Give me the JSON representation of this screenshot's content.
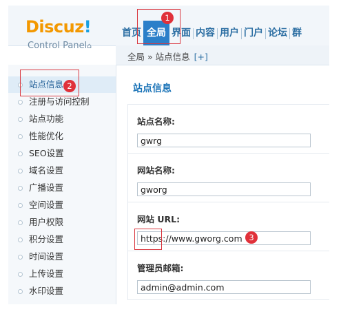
{
  "logo": {
    "brand": "Discuz",
    "bang": "!",
    "subtitle": "Control Panel",
    "subtitle_icon": "home-icon"
  },
  "topnav": {
    "items": [
      "首页",
      "全局",
      "界面",
      "内容",
      "用户",
      "门户",
      "论坛",
      "群"
    ],
    "active_index": 1
  },
  "breadcrumb": {
    "path": "全局 » 站点信息",
    "toggle": "[+]"
  },
  "sidebar": {
    "items": [
      "站点信息",
      "注册与访问控制",
      "站点功能",
      "性能优化",
      "SEO设置",
      "域名设置",
      "广播设置",
      "空间设置",
      "用户权限",
      "积分设置",
      "时间设置",
      "上传设置",
      "水印设置"
    ],
    "active_index": 0
  },
  "main": {
    "title": "站点信息",
    "fields": [
      {
        "label": "站点名称:",
        "value": "gwrg"
      },
      {
        "label": "网站名称:",
        "value": "gworg"
      },
      {
        "label": "网站 URL:",
        "value": "https://www.gworg.com"
      },
      {
        "label": "管理员邮箱:",
        "value": "admin@admin.com"
      }
    ]
  },
  "annotations": {
    "badges": [
      "1",
      "2",
      "3"
    ],
    "color": "#e0313a"
  },
  "colors": {
    "accent": "#2b7fc9",
    "logo_orange": "#f39800",
    "logo_blue": "#19a0e0",
    "title_blue": "#1a73b7"
  }
}
